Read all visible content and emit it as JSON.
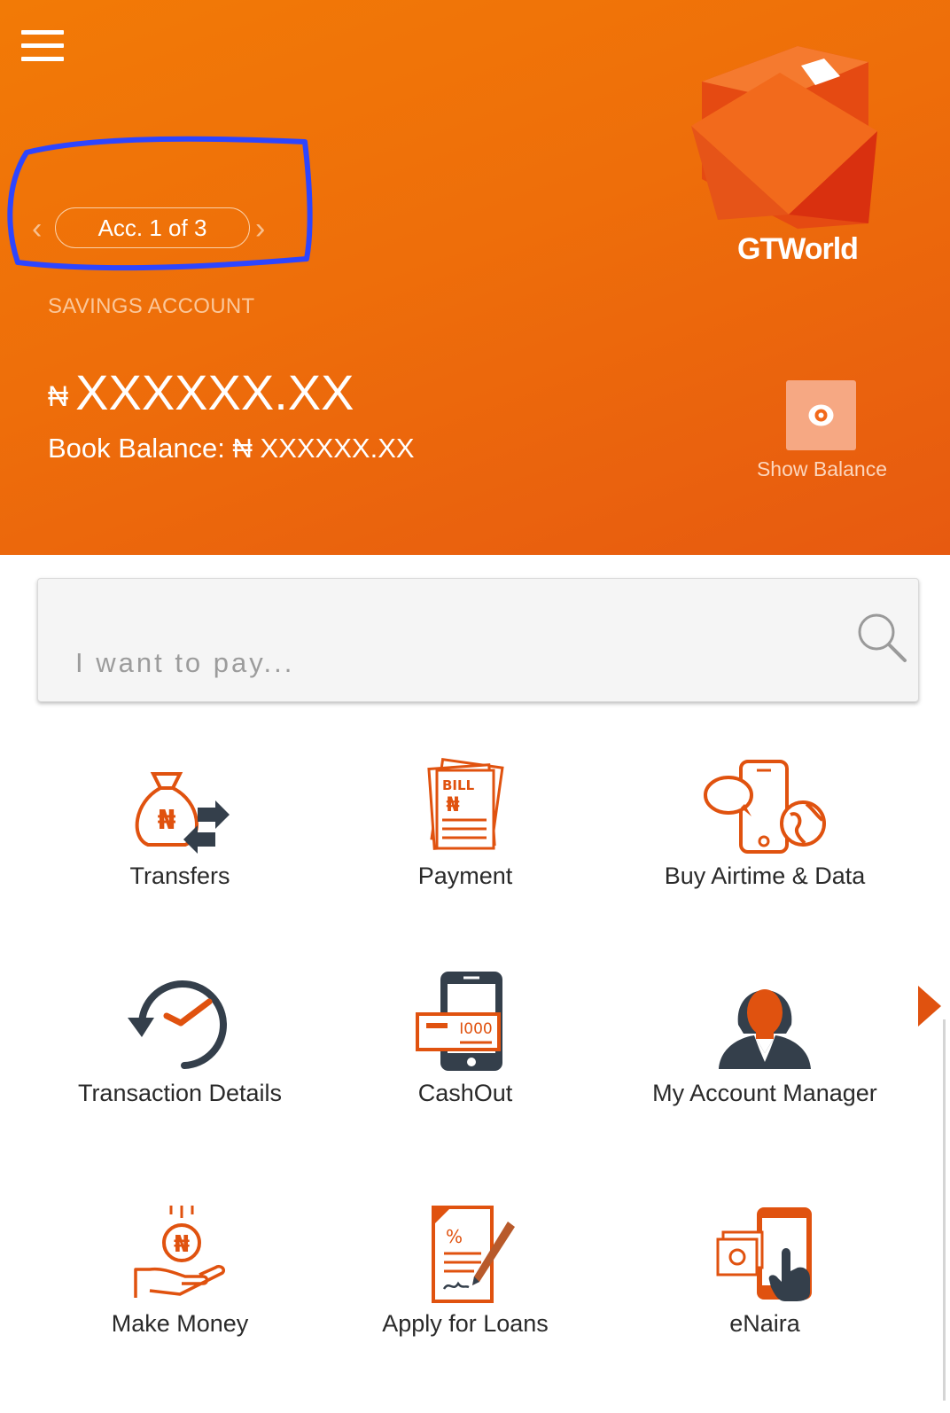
{
  "header": {
    "logo_text": "GTWorld",
    "account_pager": {
      "label": "Acc. 1 of 3",
      "prev": "‹",
      "next": "›"
    },
    "account_type": "SAVINGS ACCOUNT",
    "currency_symbol": "₦",
    "available_balance": "XXXXXX.XX",
    "book_balance_label": "Book Balance: ₦ XXXXXX.XX",
    "show_balance_label": "Show Balance"
  },
  "search": {
    "placeholder": "I want to pay..."
  },
  "menu": {
    "items": [
      {
        "label": "Transfers",
        "icon": "money-bag-transfer-icon"
      },
      {
        "label": "Payment",
        "icon": "bill-icon"
      },
      {
        "label": "Buy Airtime & Data",
        "icon": "phone-chat-globe-icon"
      },
      {
        "label": "Transaction Details",
        "icon": "history-clock-icon"
      },
      {
        "label": "CashOut",
        "icon": "phone-cash-icon"
      },
      {
        "label": "My Account Manager",
        "icon": "account-manager-icon"
      },
      {
        "label": "Make Money",
        "icon": "hand-coin-icon"
      },
      {
        "label": "Apply for Loans",
        "icon": "loan-document-icon"
      },
      {
        "label": "eNaira",
        "icon": "phone-tap-icon"
      }
    ],
    "icon_text": {
      "bill": "BILL",
      "naira": "₦",
      "cash_amount": "I000",
      "percent": "%"
    }
  },
  "colors": {
    "brand_orange": "#f27a06",
    "icon_orange": "#e0520f",
    "icon_dark": "#343f4b",
    "annotation_blue": "#2d45ff"
  }
}
